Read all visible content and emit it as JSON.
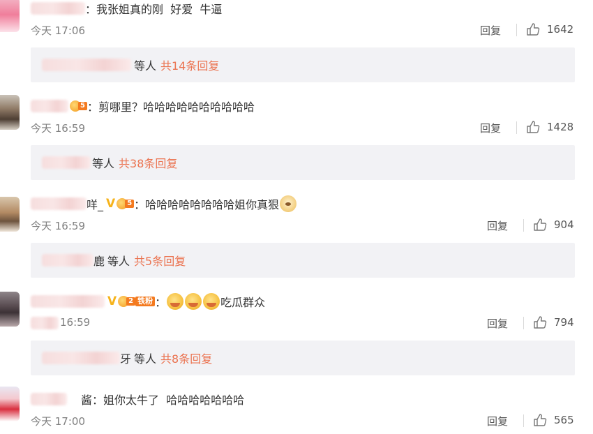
{
  "reply_label": "回复",
  "comments": [
    {
      "prefix": "：",
      "text": "我张姐真的刚  好爱  牛逼",
      "time": "今天 17:06",
      "likes": "1642",
      "sub": {
        "tail": "等人",
        "more": "共14条回复"
      }
    },
    {
      "prefix": "：",
      "text": "剪哪里？哈哈哈哈哈哈哈哈哈哈",
      "time": "今天 16:59",
      "likes": "1428",
      "sub": {
        "tail": "等人",
        "more": "共38条回复"
      }
    },
    {
      "name_tail": "咩_",
      "prefix": "：",
      "text": "哈哈哈哈哈哈哈哈姐你真狠",
      "time": "今天 16:59",
      "likes": "904",
      "sub": {
        "name_tail": "鹿",
        "tail": "等人",
        "more": "共5条回复"
      }
    },
    {
      "fan_label": "铁粉",
      "prefix": "：",
      "text": "吃瓜群众",
      "time": "16:59",
      "likes": "794",
      "sub": {
        "name_tail": "牙",
        "tail": "等人",
        "more": "共8条回复"
      }
    },
    {
      "name_tail": "酱",
      "prefix": "：",
      "text": "姐你太牛了  哈哈哈哈哈哈哈",
      "time": "今天 17:00",
      "likes": "565"
    }
  ],
  "colors": {
    "accent": "#eb7350",
    "subreply_bg": "#f2f2f5",
    "meta": "#808080"
  }
}
